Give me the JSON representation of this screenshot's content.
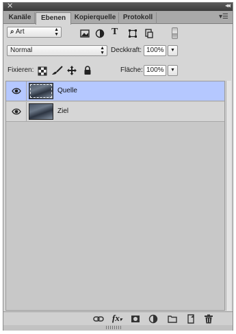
{
  "tabs": [
    {
      "label": "Kanäle"
    },
    {
      "label": "Ebenen"
    },
    {
      "label": "Kopierquelle"
    },
    {
      "label": "Protokoll"
    }
  ],
  "filter": {
    "kind_label": "Art"
  },
  "blend": {
    "mode": "Normal",
    "opacity_label": "Deckkraft:",
    "opacity_value": "100%"
  },
  "lock": {
    "label": "Fixieren:",
    "fill_label": "Fläche:",
    "fill_value": "100%"
  },
  "layers": [
    {
      "name": "Quelle",
      "selected": true
    },
    {
      "name": "Ziel",
      "selected": false
    }
  ],
  "colors": {
    "selected_row": "#b5c8ff",
    "panel": "#d6d6d6"
  }
}
